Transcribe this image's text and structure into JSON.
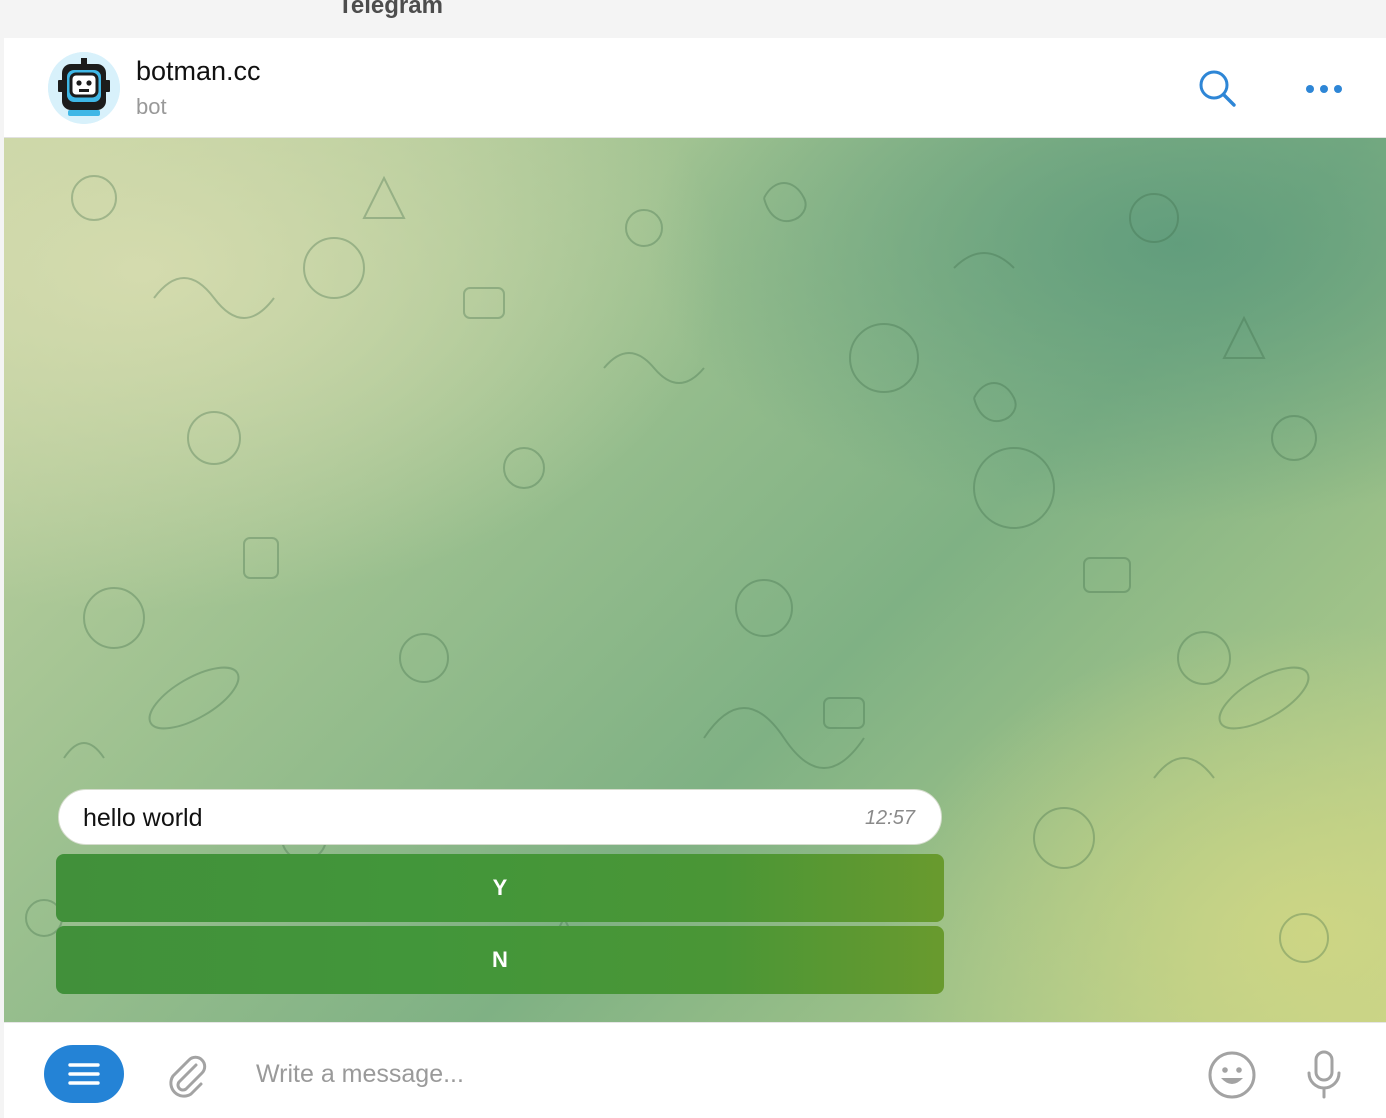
{
  "app": {
    "title": "Telegram"
  },
  "chat": {
    "name": "botman.cc",
    "status": "bot"
  },
  "header_icons": {
    "search": "search-icon",
    "more": "more-dots-icon"
  },
  "messages": [
    {
      "text": "hello world",
      "time": "12:57"
    }
  ],
  "keyboard": {
    "buttons": [
      "Y",
      "N"
    ]
  },
  "composer": {
    "placeholder": "Write a message...",
    "icons": [
      "menu-icon",
      "paperclip-icon",
      "emoji-icon",
      "microphone-icon"
    ]
  },
  "colors": {
    "accent": "#2483d6",
    "keyboard_button": "#42963a",
    "bubble": "#ffffff"
  }
}
